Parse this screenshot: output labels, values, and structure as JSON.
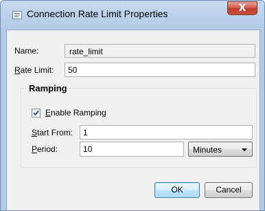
{
  "window": {
    "title": "Connection Rate Limit Properties",
    "close_label": "X",
    "title_icon": "properties-icon"
  },
  "form": {
    "name_label": "Name:",
    "name_value": "rate_limit",
    "rate_limit_label_accel": "R",
    "rate_limit_label_rest": "ate Limit:",
    "rate_limit_value": "50"
  },
  "ramping": {
    "group_title": "Ramping",
    "enable_checked": true,
    "enable_label_accel": "E",
    "enable_label_rest": "nable Ramping",
    "start_from_label_accel": "S",
    "start_from_label_rest": "tart From:",
    "start_from_value": "1",
    "period_label_accel": "P",
    "period_label_rest": "eriod:",
    "period_value": "10",
    "period_unit_selected": "Minutes"
  },
  "buttons": {
    "ok_label": "OK",
    "cancel_label": "Cancel"
  },
  "colors": {
    "title_bar": "#b9cfe9",
    "close_button": "#c9523e",
    "dialog_background": "#f0f0f0",
    "default_button_border": "#3c7fb1"
  }
}
